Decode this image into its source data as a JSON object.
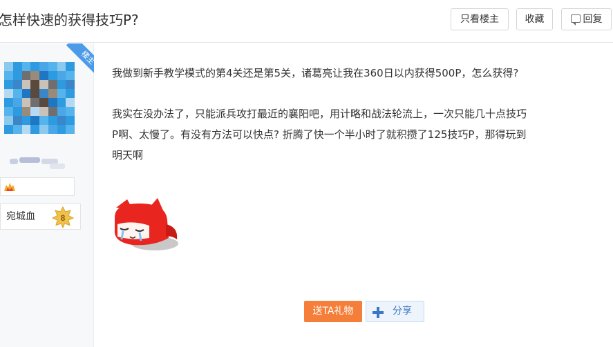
{
  "thread": {
    "title": "怎样快速的获得技巧P?"
  },
  "toolbar": {
    "only_lz_label": "只看楼主",
    "favorite_label": "收藏",
    "reply_label": "回复",
    "reply_icon": "reply-bubble-icon"
  },
  "author": {
    "ribbon_label": "楼主",
    "avatar_icon": "pixelated-avatar",
    "level_title": "宛城血",
    "level_number": "8",
    "badge_icon": "flame-badge-icon"
  },
  "post": {
    "paragraph1": "我做到新手教学模式的第4关还是第5关，诸葛亮让我在360日以内获得500P，怎么获得?",
    "paragraph2_lines": [
      "我实在没办法了，只能派兵攻打最近的襄阳吧，用计略和战法轮流上，一次只能几十点技巧",
      "P啊、太慢了。有没有方法可以快点? 折腾了快一个半小时了就积攒了125技巧P，那得玩到",
      "明天啊"
    ],
    "emoji_icon": "red-fox-crying-emoji"
  },
  "actions": {
    "gift_label": "送TA礼物",
    "share_label": "分享",
    "share_icon": "plus-share-icon"
  },
  "colors": {
    "gift_button": "#f57f3a",
    "share_text": "#3b77c4",
    "ribbon": "#4b9be8"
  }
}
